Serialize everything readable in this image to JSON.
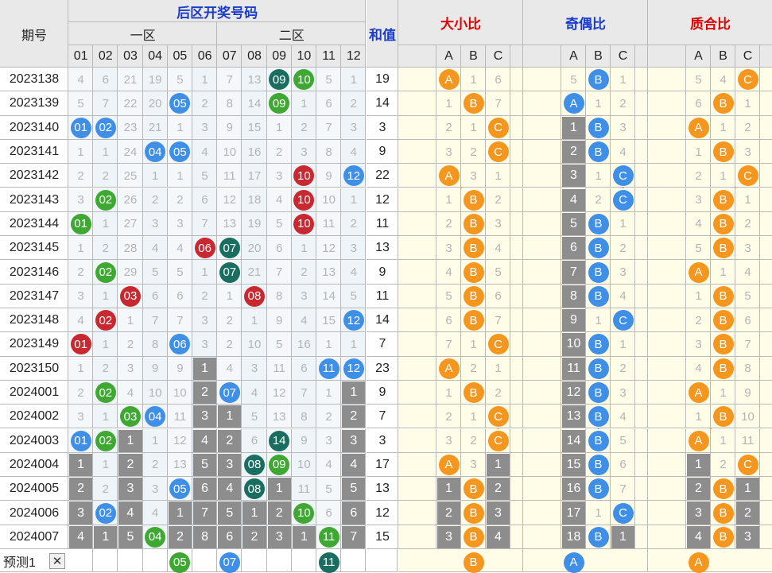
{
  "header": {
    "period_label": "期号",
    "back_zone_label": "后区开奖号码",
    "zone1_label": "一区",
    "zone2_label": "二区",
    "sum_label": "和值",
    "size_label": "大小比",
    "parity_label": "奇偶比",
    "prime_label": "质合比",
    "abc": [
      "A",
      "B",
      "C"
    ],
    "numbers": [
      "01",
      "02",
      "03",
      "04",
      "05",
      "06",
      "07",
      "08",
      "09",
      "10",
      "11",
      "12"
    ]
  },
  "predict": {
    "label": "预测1",
    "close_icon": "close-icon",
    "balls": [
      5,
      7,
      11
    ],
    "size": "B",
    "parity": "A",
    "prime": "A"
  },
  "colors": {
    "blue": "#3f8fe6",
    "green": "#3fa833",
    "red": "#c8282f",
    "teal": "#1a6e60",
    "orange": "#f5961e",
    "grey": "#8d8d8d",
    "line_orange": "#f5961e",
    "line_blue": "#3f8fe6"
  },
  "rows": [
    {
      "period": "2023138",
      "cells": [
        "4",
        "6",
        "21",
        "19",
        "5",
        "1",
        "7",
        "13",
        "b:09:teal",
        "b:10:green",
        "5",
        "1"
      ],
      "sum": "19",
      "size": {
        "hit": 0,
        "cells": [
          "A",
          "1",
          "6"
        ]
      },
      "parity": {
        "hit": 1,
        "cells": [
          "5",
          "B",
          "1"
        ]
      },
      "prime": {
        "hit": 2,
        "cells": [
          "5",
          "4",
          "C"
        ]
      }
    },
    {
      "period": "2023139",
      "cells": [
        "5",
        "7",
        "22",
        "20",
        "b:05:blue",
        "2",
        "8",
        "14",
        "b:09:green",
        "1",
        "6",
        "2"
      ],
      "sum": "14",
      "size": {
        "hit": 1,
        "cells": [
          "1",
          "B",
          "7"
        ]
      },
      "parity": {
        "hit": 0,
        "cells": [
          "A",
          "1",
          "2"
        ]
      },
      "prime": {
        "hit": 1,
        "cells": [
          "6",
          "B",
          "1"
        ]
      }
    },
    {
      "period": "2023140",
      "cells": [
        "b:01:blue",
        "b:02:blue",
        "23",
        "21",
        "1",
        "3",
        "9",
        "15",
        "1",
        "2",
        "7",
        "3"
      ],
      "sum": "3",
      "size": {
        "hit": 2,
        "cells": [
          "2",
          "1",
          "C"
        ]
      },
      "parity": {
        "hit": 1,
        "cells": [
          "g:1",
          "B",
          "3"
        ]
      },
      "prime": {
        "hit": 0,
        "cells": [
          "A",
          "1",
          "2"
        ]
      }
    },
    {
      "period": "2023141",
      "cells": [
        "1",
        "1",
        "24",
        "b:04:blue",
        "b:05:blue",
        "4",
        "10",
        "16",
        "2",
        "3",
        "8",
        "4"
      ],
      "sum": "9",
      "size": {
        "hit": 2,
        "cells": [
          "3",
          "2",
          "C"
        ]
      },
      "parity": {
        "hit": 1,
        "cells": [
          "g:2",
          "B",
          "4"
        ]
      },
      "prime": {
        "hit": 1,
        "cells": [
          "1",
          "B",
          "3"
        ]
      }
    },
    {
      "period": "2023142",
      "cells": [
        "2",
        "2",
        "25",
        "1",
        "1",
        "5",
        "11",
        "17",
        "3",
        "b:10:red",
        "9",
        "b:12:blue"
      ],
      "sum": "22",
      "size": {
        "hit": 0,
        "cells": [
          "A",
          "3",
          "1"
        ]
      },
      "parity": {
        "hit": 2,
        "cells": [
          "g:3",
          "1",
          "C"
        ]
      },
      "prime": {
        "hit": 2,
        "cells": [
          "2",
          "1",
          "C"
        ]
      }
    },
    {
      "period": "2023143",
      "cells": [
        "3",
        "b:02:green",
        "26",
        "2",
        "2",
        "6",
        "12",
        "18",
        "4",
        "b:10:red",
        "10",
        "1"
      ],
      "sum": "12",
      "size": {
        "hit": 1,
        "cells": [
          "1",
          "B",
          "2"
        ]
      },
      "parity": {
        "hit": 2,
        "cells": [
          "g:4",
          "2",
          "C"
        ]
      },
      "prime": {
        "hit": 1,
        "cells": [
          "3",
          "B",
          "1"
        ]
      }
    },
    {
      "period": "2023144",
      "cells": [
        "b:01:green",
        "1",
        "27",
        "3",
        "3",
        "7",
        "13",
        "19",
        "5",
        "b:10:red",
        "11",
        "2"
      ],
      "sum": "11",
      "size": {
        "hit": 1,
        "cells": [
          "2",
          "B",
          "3"
        ]
      },
      "parity": {
        "hit": 1,
        "cells": [
          "g:5",
          "B",
          "1"
        ]
      },
      "prime": {
        "hit": 1,
        "cells": [
          "4",
          "B",
          "2"
        ]
      }
    },
    {
      "period": "2023145",
      "cells": [
        "1",
        "2",
        "28",
        "4",
        "4",
        "b:06:red",
        "b:07:teal",
        "20",
        "6",
        "1",
        "12",
        "3"
      ],
      "sum": "13",
      "size": {
        "hit": 1,
        "cells": [
          "3",
          "B",
          "4"
        ]
      },
      "parity": {
        "hit": 1,
        "cells": [
          "g:6",
          "B",
          "2"
        ]
      },
      "prime": {
        "hit": 1,
        "cells": [
          "5",
          "B",
          "3"
        ]
      }
    },
    {
      "period": "2023146",
      "cells": [
        "2",
        "b:02:green",
        "29",
        "5",
        "5",
        "1",
        "b:07:teal",
        "21",
        "7",
        "2",
        "13",
        "4"
      ],
      "sum": "9",
      "size": {
        "hit": 1,
        "cells": [
          "4",
          "B",
          "5"
        ]
      },
      "parity": {
        "hit": 1,
        "cells": [
          "g:7",
          "B",
          "3"
        ]
      },
      "prime": {
        "hit": 0,
        "cells": [
          "A",
          "1",
          "4"
        ]
      }
    },
    {
      "period": "2023147",
      "cells": [
        "3",
        "1",
        "b:03:red",
        "6",
        "6",
        "2",
        "1",
        "b:08:red",
        "8",
        "3",
        "14",
        "5"
      ],
      "sum": "11",
      "size": {
        "hit": 1,
        "cells": [
          "5",
          "B",
          "6"
        ]
      },
      "parity": {
        "hit": 1,
        "cells": [
          "g:8",
          "B",
          "4"
        ]
      },
      "prime": {
        "hit": 1,
        "cells": [
          "1",
          "B",
          "5"
        ]
      }
    },
    {
      "period": "2023148",
      "cells": [
        "4",
        "b:02:red",
        "1",
        "7",
        "7",
        "3",
        "2",
        "1",
        "9",
        "4",
        "15",
        "b:12:blue"
      ],
      "sum": "14",
      "size": {
        "hit": 1,
        "cells": [
          "6",
          "B",
          "7"
        ]
      },
      "parity": {
        "hit": 2,
        "cells": [
          "g:9",
          "1",
          "C"
        ]
      },
      "prime": {
        "hit": 1,
        "cells": [
          "2",
          "B",
          "6"
        ]
      }
    },
    {
      "period": "2023149",
      "cells": [
        "b:01:red",
        "1",
        "2",
        "8",
        "b:06:blue",
        "3",
        "2",
        "10",
        "5",
        "16",
        "1",
        "1"
      ],
      "sum": "7",
      "size": {
        "hit": 2,
        "cells": [
          "7",
          "1",
          "C"
        ]
      },
      "parity": {
        "hit": 1,
        "cells": [
          "g:10",
          "B",
          "1"
        ]
      },
      "prime": {
        "hit": 1,
        "cells": [
          "3",
          "B",
          "7"
        ]
      }
    },
    {
      "period": "2023150",
      "cells": [
        "1",
        "2",
        "3",
        "9",
        "9",
        "g:1",
        "4",
        "3",
        "11",
        "6",
        "b:11:blue",
        "b:12:blue"
      ],
      "sum": "23",
      "size": {
        "hit": 0,
        "cells": [
          "A",
          "2",
          "1"
        ]
      },
      "parity": {
        "hit": 1,
        "cells": [
          "g:11",
          "B",
          "2"
        ]
      },
      "prime": {
        "hit": 1,
        "cells": [
          "4",
          "B",
          "8"
        ]
      }
    },
    {
      "period": "2024001",
      "cells": [
        "2",
        "b:02:green",
        "4",
        "10",
        "10",
        "g:2",
        "b:07:blue",
        "4",
        "12",
        "7",
        "1",
        "g:1"
      ],
      "sum": "9",
      "size": {
        "hit": 1,
        "cells": [
          "1",
          "B",
          "2"
        ]
      },
      "parity": {
        "hit": 1,
        "cells": [
          "g:12",
          "B",
          "3"
        ]
      },
      "prime": {
        "hit": 0,
        "cells": [
          "A",
          "1",
          "9"
        ]
      }
    },
    {
      "period": "2024002",
      "cells": [
        "3",
        "1",
        "b:03:green",
        "b:04:blue",
        "11",
        "g:3",
        "g:1",
        "5",
        "13",
        "8",
        "2",
        "g:2"
      ],
      "sum": "7",
      "size": {
        "hit": 2,
        "cells": [
          "2",
          "1",
          "C"
        ]
      },
      "parity": {
        "hit": 1,
        "cells": [
          "g:13",
          "B",
          "4"
        ]
      },
      "prime": {
        "hit": 1,
        "cells": [
          "1",
          "B",
          "10"
        ]
      }
    },
    {
      "period": "2024003",
      "cells": [
        "b:01:blue",
        "b:02:green",
        "g:1",
        "1",
        "12",
        "g:4",
        "g:2",
        "6",
        "b:14:teal",
        "9",
        "3",
        "g:3"
      ],
      "sum": "3",
      "size": {
        "hit": 2,
        "cells": [
          "3",
          "2",
          "C"
        ]
      },
      "parity": {
        "hit": 1,
        "cells": [
          "g:14",
          "B",
          "5"
        ]
      },
      "prime": {
        "hit": 0,
        "cells": [
          "A",
          "1",
          "11"
        ]
      }
    },
    {
      "period": "2024004",
      "cells": [
        "g:1",
        "1",
        "g:2",
        "2",
        "13",
        "g:5",
        "g:3",
        "b:08:teal",
        "b:09:green",
        "10",
        "4",
        "g:4"
      ],
      "sum": "17",
      "size": {
        "hit": 0,
        "cells": [
          "A",
          "3",
          "g:1"
        ]
      },
      "parity": {
        "hit": 1,
        "cells": [
          "g:15",
          "B",
          "6"
        ]
      },
      "prime": {
        "hit": 2,
        "cells": [
          "g:1",
          "2",
          "C"
        ]
      }
    },
    {
      "period": "2024005",
      "cells": [
        "g:2",
        "2",
        "g:3",
        "3",
        "b:05:blue",
        "g:6",
        "g:4",
        "b:08:teal",
        "g:1",
        "11",
        "5",
        "g:5"
      ],
      "sum": "13",
      "size": {
        "hit": 1,
        "cells": [
          "g:1",
          "B",
          "g:2"
        ]
      },
      "parity": {
        "hit": 1,
        "cells": [
          "g:16",
          "B",
          "7"
        ]
      },
      "prime": {
        "hit": 1,
        "cells": [
          "g:2",
          "B",
          "g:1"
        ]
      }
    },
    {
      "period": "2024006",
      "cells": [
        "g:3",
        "b:02:blue",
        "g:4",
        "4",
        "g:1",
        "g:7",
        "g:5",
        "g:1",
        "g:2",
        "b:10:green",
        "6",
        "g:6"
      ],
      "sum": "12",
      "size": {
        "hit": 1,
        "cells": [
          "g:2",
          "B",
          "g:3"
        ]
      },
      "parity": {
        "hit": 2,
        "cells": [
          "g:17",
          "1",
          "C"
        ]
      },
      "prime": {
        "hit": 1,
        "cells": [
          "g:3",
          "B",
          "g:2"
        ]
      }
    },
    {
      "period": "2024007",
      "cells": [
        "g:4",
        "g:1",
        "g:5",
        "b:04:green",
        "g:2",
        "g:8",
        "g:6",
        "g:2",
        "g:3",
        "g:1",
        "b:11:green",
        "g:7"
      ],
      "sum": "15",
      "size": {
        "hit": 1,
        "cells": [
          "g:3",
          "B",
          "g:4"
        ]
      },
      "parity": {
        "hit": 1,
        "cells": [
          "g:18",
          "B",
          "g:1"
        ]
      },
      "prime": {
        "hit": 1,
        "cells": [
          "g:4",
          "B",
          "g:3"
        ]
      }
    }
  ]
}
